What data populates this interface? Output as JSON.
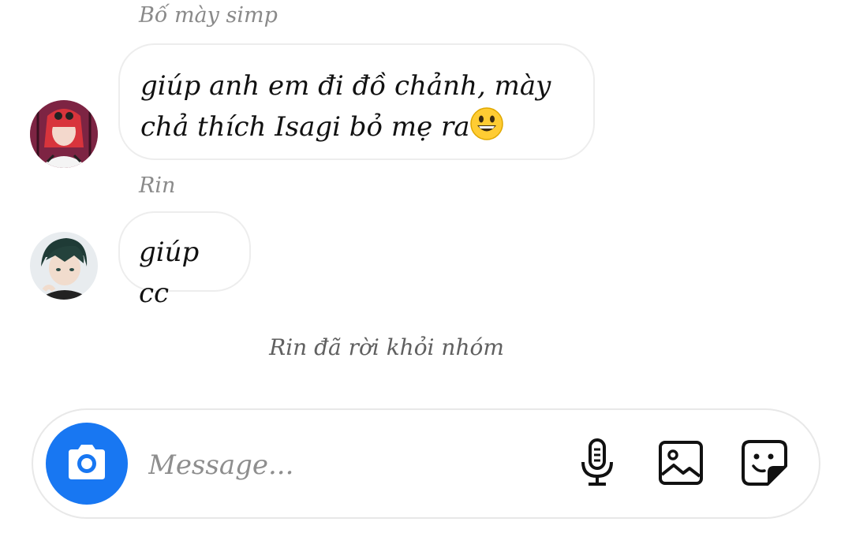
{
  "messages": [
    {
      "sender": "Bố mày simp",
      "lines": [
        "giúp anh em đi đồ chảnh, mày",
        "chả thích Isagi bỏ mẹ ra"
      ],
      "emoji": "grinning-face-emoji",
      "avatar": "red-haired-character-avatar"
    },
    {
      "sender": "Rin",
      "text": "giúp cc",
      "avatar": "dark-haired-character-avatar"
    }
  ],
  "system_note": "Rin đã rời khỏi nhóm",
  "composer": {
    "placeholder": "Message...",
    "camera_icon": "camera-icon",
    "mic_icon": "microphone-icon",
    "gallery_icon": "image-icon",
    "sticker_icon": "sticker-icon"
  },
  "colors": {
    "accent": "#1877f2",
    "bubble_border": "#ededed",
    "secondary_text": "#8a8a8a",
    "system_text": "#606060"
  }
}
